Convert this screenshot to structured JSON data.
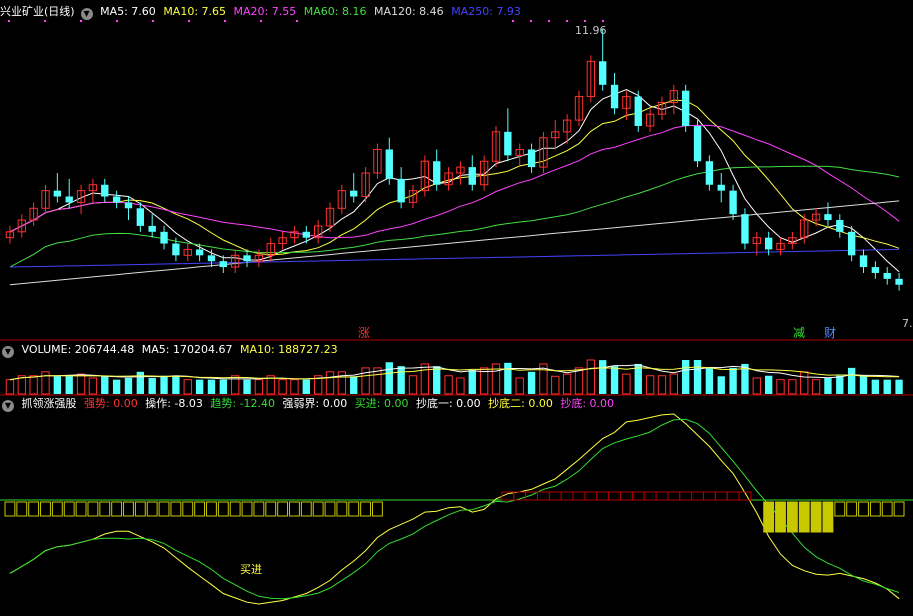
{
  "main_header": {
    "stock": "兴业矿业(日线)",
    "ma": [
      {
        "label": "MA5: 7.60",
        "color": "#ffffff"
      },
      {
        "label": "MA10: 7.65",
        "color": "#ffff44"
      },
      {
        "label": "MA20: 7.55",
        "color": "#ff44ff"
      },
      {
        "label": "MA60: 8.16",
        "color": "#44dd44"
      },
      {
        "label": "MA120: 8.46",
        "color": "#dddddd"
      },
      {
        "label": "MA250: 7.93",
        "color": "#4444ff"
      }
    ]
  },
  "volume_header": {
    "label": "VOLUME: 206744.48",
    "ma5": "MA5: 170204.67",
    "ma10": "MA10: 188727.23"
  },
  "indicator_header": {
    "name": "抓领涨强股",
    "items": [
      {
        "label": "强势: 0.00",
        "color": "#ff3333"
      },
      {
        "label": "操作: -8.03",
        "color": "#ffffff"
      },
      {
        "label": "趋势: -12.40",
        "color": "#33dd33"
      },
      {
        "label": "强弱界: 0.00",
        "color": "#ffffff"
      },
      {
        "label": "买进: 0.00",
        "color": "#33dd33"
      },
      {
        "label": "抄底一: 0.00",
        "color": "#ffffff"
      },
      {
        "label": "抄底二: 0.00",
        "color": "#ffff33"
      },
      {
        "label": "抄底: 0.00",
        "color": "#ff44ff"
      }
    ]
  },
  "annotations": {
    "high": "11.96",
    "low": "7.",
    "mark_zhang": "涨",
    "mark_jian": "减",
    "mark_cai": "财",
    "buy": "买进"
  },
  "colors": {
    "up": "#ff3030",
    "down": "#54ffff",
    "bg": "#000000",
    "frame": "#b00000"
  },
  "chart_data": {
    "type": "candlestick",
    "price_range": [
      7.0,
      12.0
    ],
    "candles": [
      [
        8.4,
        8.6,
        8.3,
        8.5
      ],
      [
        8.5,
        8.8,
        8.4,
        8.7
      ],
      [
        8.7,
        9.0,
        8.6,
        8.9
      ],
      [
        8.9,
        9.3,
        8.8,
        9.2
      ],
      [
        9.2,
        9.5,
        9.0,
        9.1
      ],
      [
        9.1,
        9.4,
        8.9,
        9.0
      ],
      [
        9.0,
        9.3,
        8.8,
        9.2
      ],
      [
        9.2,
        9.4,
        9.0,
        9.3
      ],
      [
        9.3,
        9.4,
        9.0,
        9.1
      ],
      [
        9.1,
        9.2,
        8.9,
        9.0
      ],
      [
        9.0,
        9.1,
        8.7,
        8.9
      ],
      [
        8.9,
        9.0,
        8.5,
        8.6
      ],
      [
        8.6,
        8.8,
        8.4,
        8.5
      ],
      [
        8.5,
        8.6,
        8.2,
        8.3
      ],
      [
        8.3,
        8.4,
        8.0,
        8.1
      ],
      [
        8.1,
        8.3,
        8.0,
        8.2
      ],
      [
        8.2,
        8.3,
        8.0,
        8.1
      ],
      [
        8.1,
        8.2,
        7.9,
        8.0
      ],
      [
        8.0,
        8.1,
        7.8,
        7.9
      ],
      [
        7.9,
        8.2,
        7.8,
        8.1
      ],
      [
        8.1,
        8.2,
        7.9,
        8.0
      ],
      [
        8.0,
        8.2,
        7.9,
        8.1
      ],
      [
        8.1,
        8.4,
        8.0,
        8.3
      ],
      [
        8.3,
        8.5,
        8.2,
        8.4
      ],
      [
        8.4,
        8.6,
        8.3,
        8.5
      ],
      [
        8.5,
        8.6,
        8.3,
        8.4
      ],
      [
        8.4,
        8.7,
        8.3,
        8.6
      ],
      [
        8.6,
        9.0,
        8.5,
        8.9
      ],
      [
        8.9,
        9.3,
        8.8,
        9.2
      ],
      [
        9.2,
        9.5,
        9.0,
        9.1
      ],
      [
        9.1,
        9.6,
        9.0,
        9.5
      ],
      [
        9.5,
        10.0,
        9.4,
        9.9
      ],
      [
        9.9,
        10.1,
        9.3,
        9.4
      ],
      [
        9.4,
        9.6,
        8.9,
        9.0
      ],
      [
        9.0,
        9.3,
        8.9,
        9.2
      ],
      [
        9.2,
        9.8,
        9.1,
        9.7
      ],
      [
        9.7,
        9.9,
        9.2,
        9.3
      ],
      [
        9.3,
        9.6,
        9.2,
        9.5
      ],
      [
        9.5,
        9.7,
        9.3,
        9.6
      ],
      [
        9.6,
        9.8,
        9.2,
        9.3
      ],
      [
        9.3,
        9.8,
        9.2,
        9.7
      ],
      [
        9.7,
        10.3,
        9.6,
        10.2
      ],
      [
        10.2,
        10.6,
        9.7,
        9.8
      ],
      [
        9.8,
        10.0,
        9.6,
        9.9
      ],
      [
        9.9,
        10.0,
        9.5,
        9.6
      ],
      [
        9.6,
        10.2,
        9.5,
        10.1
      ],
      [
        10.1,
        10.4,
        9.9,
        10.2
      ],
      [
        10.2,
        10.5,
        10.0,
        10.4
      ],
      [
        10.4,
        10.9,
        10.3,
        10.8
      ],
      [
        10.8,
        11.5,
        10.7,
        11.4
      ],
      [
        11.4,
        11.96,
        10.9,
        11.0
      ],
      [
        11.0,
        11.2,
        10.5,
        10.6
      ],
      [
        10.6,
        10.9,
        10.4,
        10.8
      ],
      [
        10.8,
        10.9,
        10.2,
        10.3
      ],
      [
        10.3,
        10.6,
        10.2,
        10.5
      ],
      [
        10.5,
        10.8,
        10.4,
        10.7
      ],
      [
        10.7,
        11.0,
        10.5,
        10.9
      ],
      [
        10.9,
        11.0,
        10.2,
        10.3
      ],
      [
        10.3,
        10.4,
        9.6,
        9.7
      ],
      [
        9.7,
        9.8,
        9.2,
        9.3
      ],
      [
        9.3,
        9.5,
        9.0,
        9.2
      ],
      [
        9.2,
        9.3,
        8.7,
        8.8
      ],
      [
        8.8,
        8.9,
        8.2,
        8.3
      ],
      [
        8.3,
        8.5,
        8.1,
        8.4
      ],
      [
        8.4,
        8.5,
        8.1,
        8.2
      ],
      [
        8.2,
        8.4,
        8.1,
        8.3
      ],
      [
        8.3,
        8.5,
        8.2,
        8.4
      ],
      [
        8.4,
        8.8,
        8.3,
        8.7
      ],
      [
        8.7,
        8.9,
        8.6,
        8.8
      ],
      [
        8.8,
        9.0,
        8.6,
        8.7
      ],
      [
        8.7,
        8.8,
        8.4,
        8.5
      ],
      [
        8.5,
        8.6,
        8.0,
        8.1
      ],
      [
        8.1,
        8.2,
        7.8,
        7.9
      ],
      [
        7.9,
        8.0,
        7.7,
        7.8
      ],
      [
        7.8,
        7.9,
        7.6,
        7.7
      ],
      [
        7.7,
        7.8,
        7.5,
        7.6
      ]
    ]
  }
}
